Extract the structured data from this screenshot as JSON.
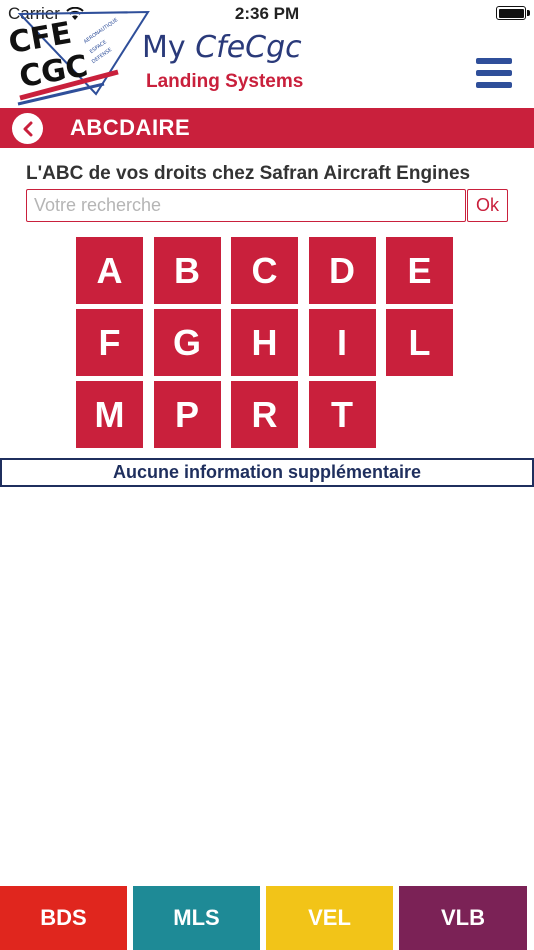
{
  "status_bar": {
    "carrier": "Carrier",
    "time": "2:36 PM",
    "wifi_icon": "wifi-icon",
    "battery_icon": "battery-icon"
  },
  "header": {
    "logo_line1": "CFE",
    "logo_line2": "CGC",
    "logo_tagline": [
      "AERONAUTIQUE",
      "ESPACE",
      "DEFENSE"
    ],
    "brand_my": "My",
    "brand_name": "CfeCgc",
    "brand_sub": "Landing Systems",
    "menu_icon": "hamburger-menu-icon"
  },
  "title_bar": {
    "back_icon": "chevron-left-icon",
    "title": "ABCDAIRE"
  },
  "main": {
    "subtitle": "L'ABC de vos droits chez Safran Aircraft Engines",
    "search": {
      "placeholder": "Votre recherche",
      "value": ""
    },
    "ok_label": "Ok",
    "letters": [
      "A",
      "B",
      "C",
      "D",
      "E",
      "F",
      "G",
      "H",
      "I",
      "L",
      "M",
      "P",
      "R",
      "T"
    ],
    "info": "Aucune information supplémentaire"
  },
  "bottom_tabs": [
    {
      "label": "BDS",
      "color": "#e0261e"
    },
    {
      "label": "MLS",
      "color": "#1e8a96"
    },
    {
      "label": "VEL",
      "color": "#f2c418"
    },
    {
      "label": "VLB",
      "color": "#7b2256"
    }
  ],
  "colors": {
    "accent": "#c9203c",
    "navy": "#1f2f5e",
    "menu": "#2f4f9a"
  }
}
